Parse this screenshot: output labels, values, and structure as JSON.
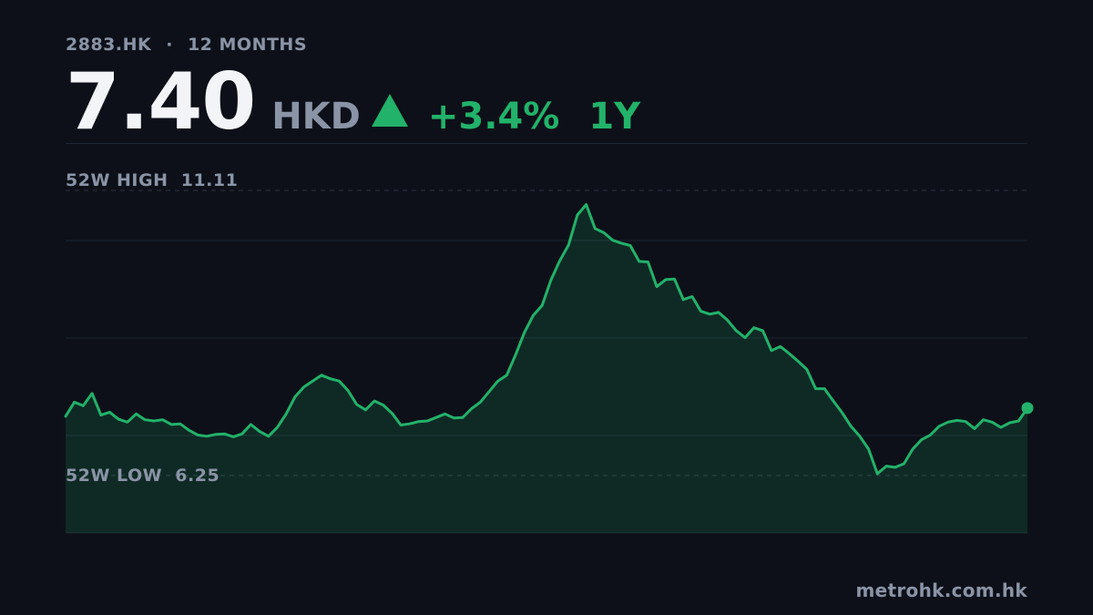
{
  "header": {
    "symbol": "2883.HK",
    "separator": "·",
    "period_label": "12 MONTHS",
    "price": "7.40",
    "currency": "HKD",
    "direction": "up",
    "change": "+3.4%",
    "range": "1Y"
  },
  "colors": {
    "background": "#0d1018",
    "accent_up": "#22b26a",
    "muted_text": "#8a94a6",
    "price_text": "#f2f4f8"
  },
  "footer": {
    "source": "metrohk.com.hk"
  },
  "chart_data": {
    "type": "area",
    "title": "",
    "xlabel": "",
    "ylabel": "",
    "ylim": [
      5.27,
      11.11
    ],
    "grid": true,
    "legend": "none",
    "high_label": "52W HIGH",
    "high_value": "11.11",
    "high": 11.11,
    "low_label": "52W LOW",
    "low_value": "6.25",
    "low": 6.25,
    "series": [
      {
        "values": [
          7.26,
          7.5,
          7.44,
          7.65,
          7.28,
          7.33,
          7.21,
          7.16,
          7.3,
          7.2,
          7.18,
          7.2,
          7.12,
          7.13,
          7.02,
          6.94,
          6.92,
          6.95,
          6.96,
          6.91,
          6.96,
          7.12,
          7.0,
          6.92,
          7.07,
          7.3,
          7.59,
          7.76,
          7.86,
          7.96,
          7.9,
          7.86,
          7.7,
          7.46,
          7.37,
          7.52,
          7.45,
          7.31,
          7.11,
          7.13,
          7.17,
          7.18,
          7.24,
          7.3,
          7.23,
          7.24,
          7.39,
          7.5,
          7.68,
          7.86,
          7.96,
          8.31,
          8.69,
          8.98,
          9.15,
          9.58,
          9.91,
          10.18,
          10.69,
          10.87,
          10.46,
          10.39,
          10.26,
          10.21,
          10.17,
          9.9,
          9.89,
          9.47,
          9.59,
          9.6,
          9.25,
          9.3,
          9.05,
          9.0,
          9.03,
          8.9,
          8.72,
          8.6,
          8.77,
          8.72,
          8.38,
          8.45,
          8.33,
          8.2,
          8.06,
          7.73,
          7.73,
          7.52,
          7.32,
          7.09,
          6.92,
          6.7,
          6.28,
          6.41,
          6.39,
          6.45,
          6.7,
          6.86,
          6.94,
          7.09,
          7.16,
          7.19,
          7.17,
          7.05,
          7.2,
          7.16,
          7.07,
          7.15,
          7.18,
          7.4
        ]
      }
    ]
  }
}
